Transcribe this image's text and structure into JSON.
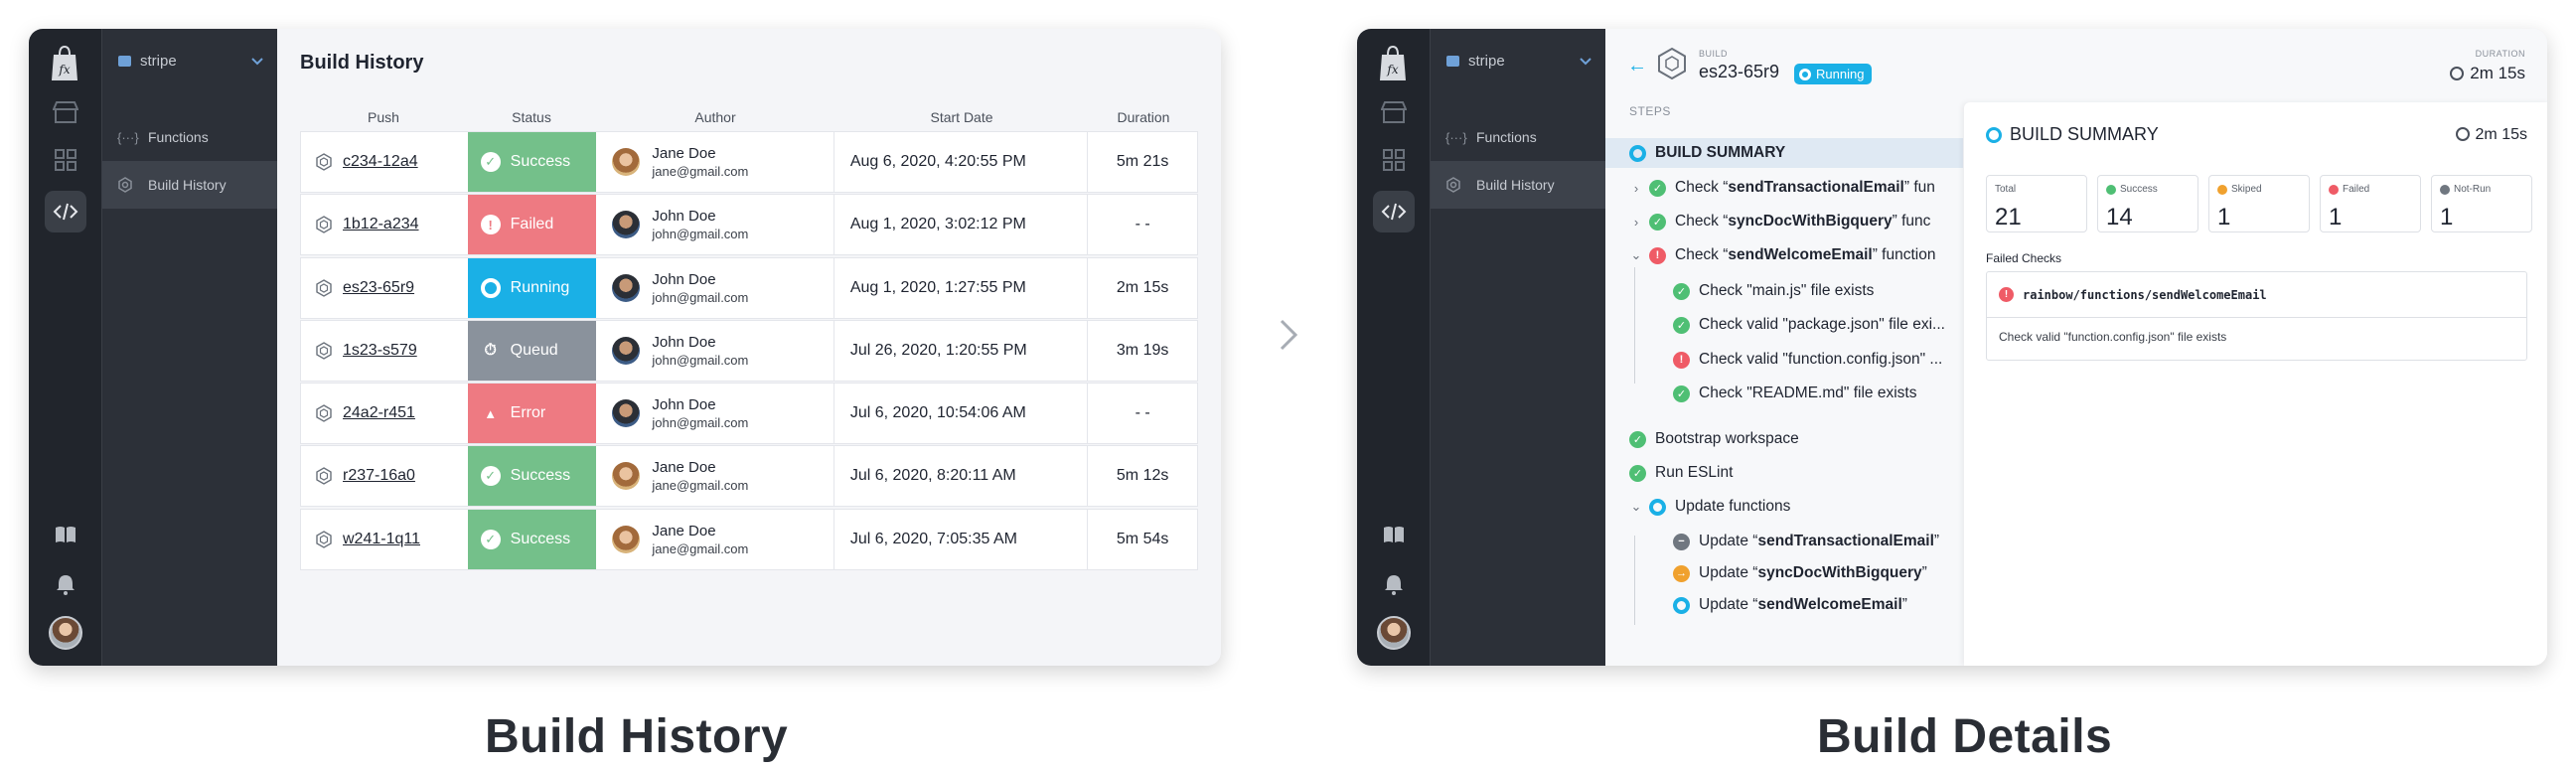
{
  "project": "stripe",
  "nav": {
    "functions": "Functions",
    "build_history": "Build History"
  },
  "history": {
    "title": "Build History",
    "columns": [
      "Push",
      "Status",
      "Author",
      "Start Date",
      "Duration"
    ],
    "rows": [
      {
        "push": "c234-12a4",
        "status": "Success",
        "status_kind": "success",
        "author": "Jane Doe",
        "email": "jane@gmail.com",
        "avatar": "female",
        "date": "Aug 6, 2020, 4:20:55 PM",
        "duration": "5m 21s"
      },
      {
        "push": "1b12-a234",
        "status": "Failed",
        "status_kind": "failed",
        "author": "John Doe",
        "email": "john@gmail.com",
        "avatar": "male",
        "date": "Aug 1, 2020, 3:02:12 PM",
        "duration": "- -"
      },
      {
        "push": "es23-65r9",
        "status": "Running",
        "status_kind": "running",
        "author": "John Doe",
        "email": "john@gmail.com",
        "avatar": "male",
        "date": "Aug 1, 2020, 1:27:55 PM",
        "duration": "2m 15s"
      },
      {
        "push": "1s23-s579",
        "status": "Queud",
        "status_kind": "queued",
        "author": "John Doe",
        "email": "john@gmail.com",
        "avatar": "male",
        "date": "Jul 26, 2020, 1:20:55 PM",
        "duration": "3m 19s"
      },
      {
        "push": "24a2-r451",
        "status": "Error",
        "status_kind": "error",
        "author": "John Doe",
        "email": "john@gmail.com",
        "avatar": "male",
        "date": "Jul 6, 2020, 10:54:06 AM",
        "duration": "- -"
      },
      {
        "push": "r237-16a0",
        "status": "Success",
        "status_kind": "success",
        "author": "Jane Doe",
        "email": "jane@gmail.com",
        "avatar": "female",
        "date": "Jul 6, 2020, 8:20:11 AM",
        "duration": "5m 12s"
      },
      {
        "push": "w241-1q11",
        "status": "Success",
        "status_kind": "success",
        "author": "Jane Doe",
        "email": "jane@gmail.com",
        "avatar": "female",
        "date": "Jul 6, 2020, 7:05:35 AM",
        "duration": "5m 54s"
      }
    ]
  },
  "details": {
    "build_label": "BUILD",
    "build_id": "es23-65r9",
    "status": "Running",
    "duration_label": "DURATION",
    "duration": "2m 15s",
    "steps_label": "STEPS",
    "steps": [
      {
        "pre": "",
        "bold": "BUILD SUMMARY",
        "post": "",
        "kind": "running",
        "caret": "",
        "level": 0,
        "selected": true
      },
      {
        "pre": "Check “",
        "bold": "sendTransactionalEmail",
        "post": "” fun",
        "kind": "success",
        "caret": "›",
        "level": 0
      },
      {
        "pre": "Check “",
        "bold": "syncDocWithBigquery",
        "post": "” func",
        "kind": "success",
        "caret": "›",
        "level": 0
      },
      {
        "pre": "Check “",
        "bold": "sendWelcomeEmail",
        "post": "” function",
        "kind": "failed",
        "caret": "⌄",
        "level": 0
      },
      {
        "pre": "Check \"main.js\" file exists",
        "bold": "",
        "post": "",
        "kind": "success",
        "caret": "",
        "level": 1
      },
      {
        "pre": "Check valid \"package.json\" file exi...",
        "bold": "",
        "post": "",
        "kind": "success",
        "caret": "",
        "level": 1
      },
      {
        "pre": "Check valid \"function.config.json\" ...",
        "bold": "",
        "post": "",
        "kind": "failed",
        "caret": "",
        "level": 1
      },
      {
        "pre": "Check \"README.md\" file exists",
        "bold": "",
        "post": "",
        "kind": "success",
        "caret": "",
        "level": 1
      },
      {
        "pre": "Bootstrap workspace",
        "bold": "",
        "post": "",
        "kind": "success",
        "caret": "",
        "level": 0
      },
      {
        "pre": "Run ESLint",
        "bold": "",
        "post": "",
        "kind": "success",
        "caret": "",
        "level": 0
      },
      {
        "pre": "Update functions",
        "bold": "",
        "post": "",
        "kind": "running",
        "caret": "⌄",
        "level": 0
      },
      {
        "pre": "Update “",
        "bold": "sendTransactionalEmail",
        "post": "”",
        "kind": "notrun",
        "caret": "",
        "level": 1
      },
      {
        "pre": "Update “",
        "bold": "syncDocWithBigquery",
        "post": "”",
        "kind": "skipped",
        "caret": "",
        "level": 1
      },
      {
        "pre": "Update “",
        "bold": "sendWelcomeEmail",
        "post": "”",
        "kind": "running",
        "caret": "",
        "level": 1
      }
    ],
    "summary": {
      "title": "BUILD SUMMARY",
      "duration": "2m 15s",
      "stats": [
        {
          "label": "Total",
          "value": "21",
          "kind": ""
        },
        {
          "label": "Success",
          "value": "14",
          "kind": "success"
        },
        {
          "label": "Skiped",
          "value": "1",
          "kind": "skipped"
        },
        {
          "label": "Failed",
          "value": "1",
          "kind": "failed"
        },
        {
          "label": "Not-Run",
          "value": "1",
          "kind": "notrun"
        }
      ],
      "failed_checks_label": "Failed Checks",
      "failed_check_path": "rainbow/functions/sendWelcomeEmail",
      "failed_check_detail": "Check valid \"function.config.json\" file exists"
    }
  },
  "captions": {
    "left": "Build History",
    "right": "Build Details"
  },
  "colors": {
    "success": "#74c08a",
    "failed": "#ee7a82",
    "running": "#1ab0e6",
    "queued": "#8a929c",
    "rail": "#21252c",
    "sidenav": "#2c3038"
  },
  "icons": [
    "fx-bag-logo",
    "store-icon",
    "apps-grid-icon",
    "code-icon",
    "book-icon",
    "bell-icon",
    "folder-icon",
    "functions-icon",
    "hexagon-build-icon",
    "clock-icon",
    "back-arrow-icon",
    "chevron-right-icon"
  ]
}
